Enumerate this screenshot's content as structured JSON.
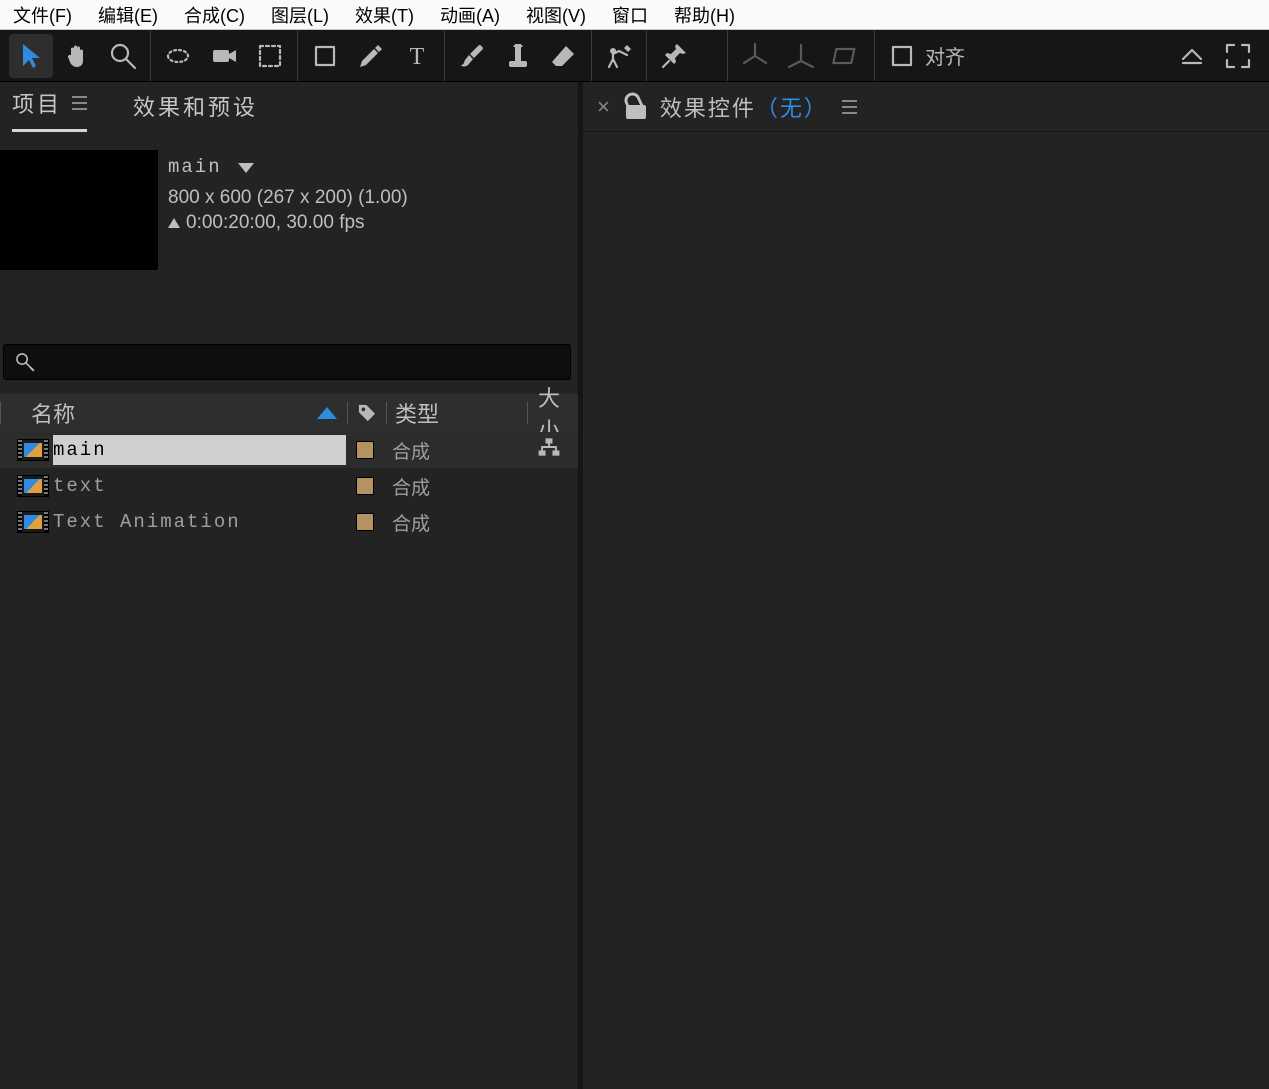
{
  "menu": {
    "file": "文件(F)",
    "edit": "编辑(E)",
    "comp": "合成(C)",
    "layer": "图层(L)",
    "effect": "效果(T)",
    "anim": "动画(A)",
    "view": "视图(V)",
    "window": "窗口",
    "help": "帮助(H)"
  },
  "toolbar": {
    "align": "对齐"
  },
  "panels": {
    "project_tab": "项目",
    "effects_presets_tab": "效果和预设",
    "effect_controls_tab": "效果控件",
    "effect_controls_none": "（无）"
  },
  "comp": {
    "name": "main",
    "line1": "800 x 600  (267 x 200) (1.00)",
    "line2": "0:00:20:00, 30.00 fps"
  },
  "columns": {
    "name": "名称",
    "type": "类型",
    "size": "大小"
  },
  "rows": [
    {
      "name": "main",
      "type": "合成",
      "selected": true,
      "flow": true
    },
    {
      "name": "text",
      "type": "合成",
      "selected": false,
      "flow": false
    },
    {
      "name": "Text Animation",
      "type": "合成",
      "selected": false,
      "flow": false
    }
  ]
}
